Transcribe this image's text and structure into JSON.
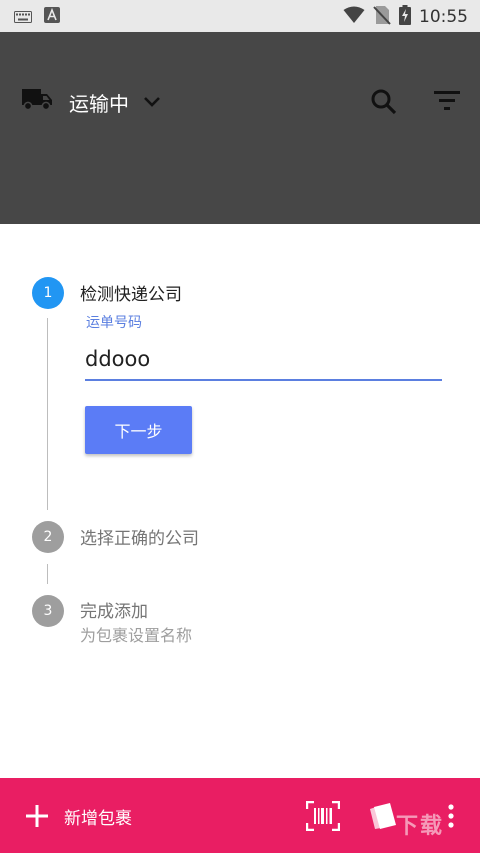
{
  "status_bar": {
    "time": "10:55",
    "icons": [
      "keyboard-icon",
      "app-notification-icon",
      "wifi-icon",
      "no-sim-icon",
      "battery-charging-icon"
    ]
  },
  "header": {
    "status_filter_label": "运输中",
    "icons": [
      "truck-icon",
      "chevron-down-icon",
      "search-icon",
      "filter-icon"
    ],
    "background_color": "#474747"
  },
  "stepper": {
    "steps": [
      {
        "number": "1",
        "title": "检测快递公司",
        "state": "active"
      },
      {
        "number": "2",
        "title": "选择正确的公司",
        "state": "inactive"
      },
      {
        "number": "3",
        "title": "完成添加",
        "subtitle": "为包裹设置名称",
        "state": "inactive"
      }
    ],
    "active_color": "#2196f3",
    "inactive_color": "#9e9e9e"
  },
  "form": {
    "field_label": "运单号码",
    "field_value": "ddooo",
    "next_button_label": "下一步",
    "accent_color": "#5b7cf6"
  },
  "bottom_bar": {
    "add_label": "新增包裹",
    "icons": [
      "add-icon",
      "barcode-scan-icon",
      "card-icon",
      "more-vert-icon"
    ],
    "background_color": "#e91e63",
    "watermark": "下载"
  }
}
